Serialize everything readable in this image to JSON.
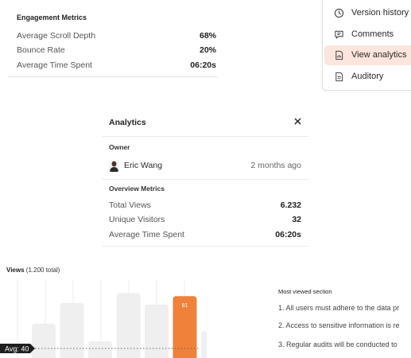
{
  "engagement": {
    "title": "Engagement Metrics",
    "rows": [
      {
        "label": "Average Scroll Depth",
        "value": "68%"
      },
      {
        "label": "Bounce Rate",
        "value": "20%"
      },
      {
        "label": "Average Time Spent",
        "value": "06:20s"
      }
    ]
  },
  "menu": {
    "items": [
      {
        "label": "Version history",
        "icon": "clock-icon",
        "active": false
      },
      {
        "label": "Comments",
        "icon": "comment-icon",
        "active": false
      },
      {
        "label": "View analytics",
        "icon": "analytics-doc-icon",
        "active": true
      },
      {
        "label": "Auditory",
        "icon": "document-icon",
        "active": false
      }
    ],
    "active_color": "#fbe5dc"
  },
  "analytics": {
    "title": "Analytics",
    "close_icon": "close-icon",
    "owner_section": "Owner",
    "owner": {
      "name": "Eric Wang",
      "time": "2 months ago"
    },
    "overview_section": "Overview Metrics",
    "metrics": [
      {
        "label": "Total Views",
        "value": "6.232"
      },
      {
        "label": "Unique Visitors",
        "value": "32"
      },
      {
        "label": "Average Time Spent",
        "value": "06:20s"
      }
    ]
  },
  "views": {
    "title": "Views",
    "subtitle": "(1.200 total)"
  },
  "chart_data": {
    "type": "bar",
    "title": "Views",
    "subtitle": "(1.200 total)",
    "values": [
      45,
      72,
      22,
      85,
      70,
      81,
      35
    ],
    "highlight_index": 5,
    "highlight_label": "81",
    "average_label": "Avg: 40",
    "average": 40,
    "ylim": [
      0,
      100
    ],
    "colors": {
      "bar": "#efefef",
      "highlight": "#f0813a",
      "grid": "#eeeeee"
    }
  },
  "most_viewed": {
    "title": "Most viewed section",
    "items": [
      "1.  All users must adhere to the data pr",
      "2.  Access to sensitive information is re",
      "3.  Regular audits will be conducted to"
    ]
  }
}
